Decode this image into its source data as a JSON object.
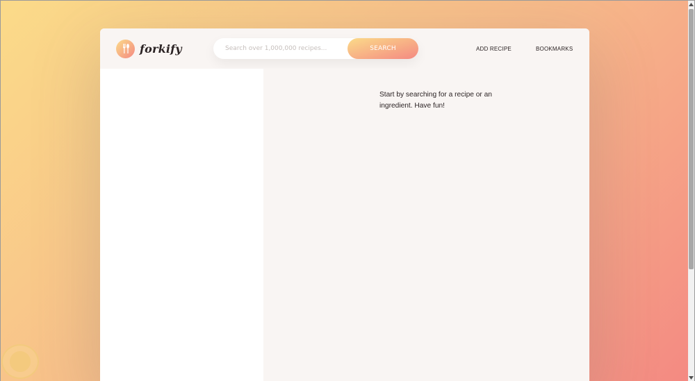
{
  "header": {
    "logo_text": "forkify",
    "search": {
      "placeholder": "Search over 1,000,000 recipes...",
      "button_label": "SEARCH"
    },
    "nav": {
      "add_recipe": "ADD RECIPE",
      "bookmarks": "BOOKMARKS"
    }
  },
  "recipe": {
    "message": "Start by searching for a recipe or an ingredient. Have fun!"
  },
  "icons": {
    "logo": "fork-spoon-icon",
    "scroll_up": "chevron-up-icon",
    "scroll_down": "chevron-down-icon"
  },
  "colors": {
    "gradient_start": "#fbdb89",
    "gradient_end": "#f48982",
    "panel_bg": "#f9f5f3",
    "text": "#2b2324"
  }
}
